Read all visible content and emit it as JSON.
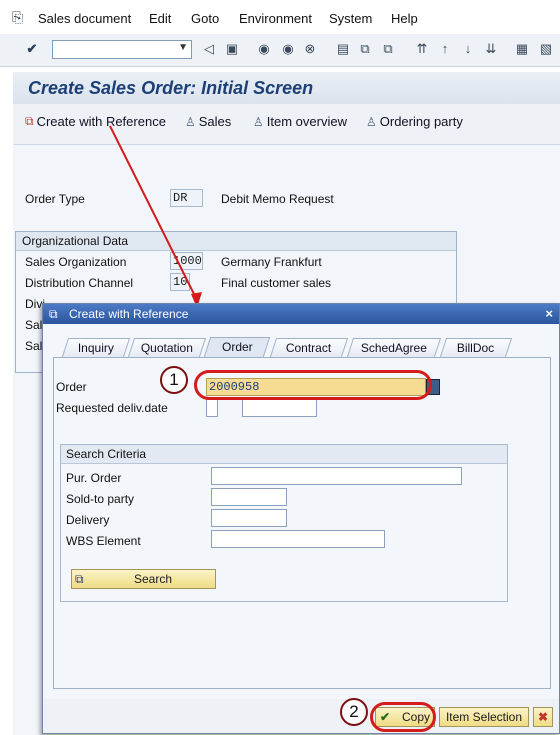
{
  "menu": [
    "Sales document",
    "Edit",
    "Goto",
    "Environment",
    "System",
    "Help"
  ],
  "icons": {
    "check": "check-icon",
    "dropdown": "chevron-down-icon"
  },
  "title": "Create Sales Order: Initial Screen",
  "app_toolbar": [
    "Create with Reference",
    "Sales",
    "Item overview",
    "Ordering party"
  ],
  "order_type": {
    "label": "Order Type",
    "value": "DR",
    "description": "Debit Memo Request"
  },
  "org_data": {
    "heading": "Organizational Data",
    "rows": [
      {
        "label": "Sales Organization",
        "value": "1000",
        "description": "Germany Frankfurt"
      },
      {
        "label": "Distribution Channel",
        "value": "10",
        "description": "Final customer sales"
      },
      {
        "label": "Divi",
        "value": "",
        "description": ""
      },
      {
        "label": "Sal",
        "value": "",
        "description": ""
      },
      {
        "label": "Sal",
        "value": "",
        "description": ""
      }
    ]
  },
  "dialog": {
    "title": "Create with Reference",
    "tabs": [
      "Inquiry",
      "Quotation",
      "Order",
      "Contract",
      "SchedAgree",
      "BillDoc"
    ],
    "active_tab": "Order",
    "order_label": "Order",
    "order_value": "2000958",
    "req_deliv_label": "Requested deliv.date",
    "search": {
      "heading": "Search Criteria",
      "fields": [
        "Pur. Order",
        "Sold-to party",
        "Delivery",
        "WBS Element"
      ],
      "button": "Search"
    },
    "footer": {
      "copy": "Copy",
      "item_selection": "Item Selection"
    }
  },
  "callouts": [
    "1",
    "2"
  ],
  "colors": {
    "accent": "#1c3f75",
    "annotation": "#d41c1c",
    "field_highlight": "#f6dc93"
  }
}
